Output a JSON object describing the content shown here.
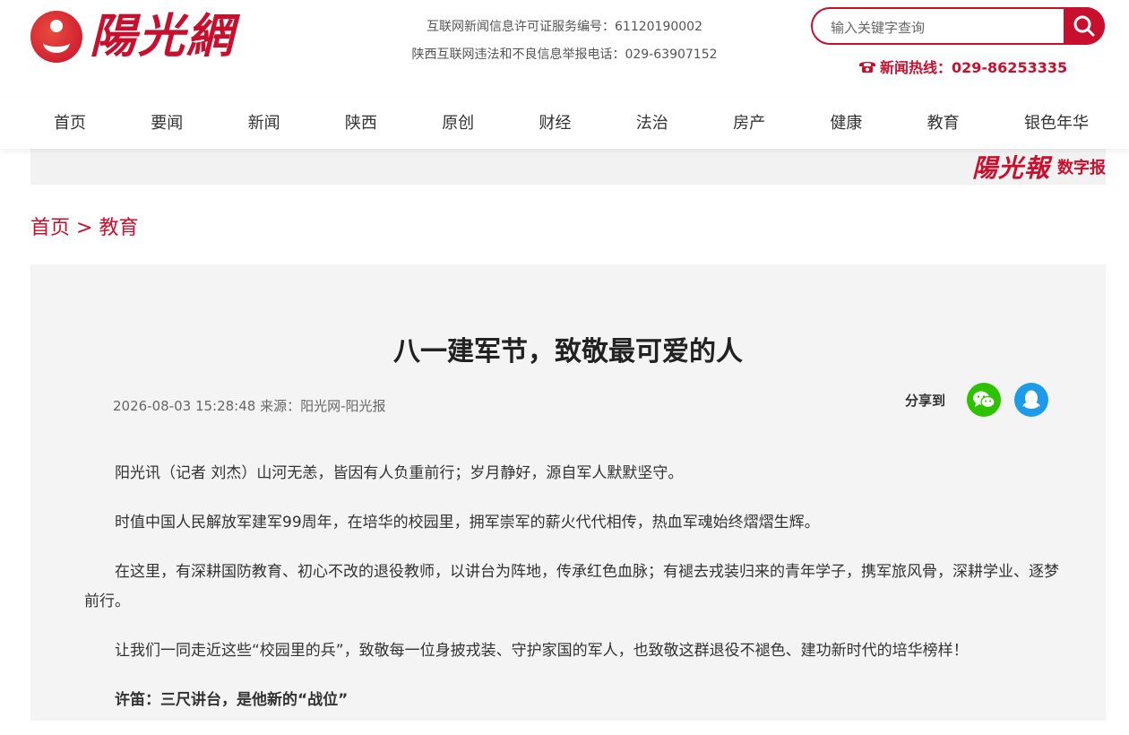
{
  "site": {
    "logo_text": "陽光網",
    "license_line1": "互联网新闻信息许可证服务编号：61120190002",
    "license_line2": "陕西互联网违法和不良信息举报电话：029-63907152",
    "search_placeholder": "输入关键字查询",
    "hotline": "新闻热线：029-86253335"
  },
  "nav": [
    "首页",
    "要闻",
    "新闻",
    "陕西",
    "原创",
    "财经",
    "法治",
    "房产",
    "健康",
    "教育",
    "银色年华"
  ],
  "epaper": {
    "logo_text": "陽光報",
    "label": "数字报"
  },
  "breadcrumb": {
    "home": "首页",
    "separator": ">",
    "current": "教育"
  },
  "article": {
    "title": "八一建军节，致敬最可爱的人",
    "meta": "2026-08-03 15:28:48 来源：阳光网-阳光报",
    "share_label": "分享到",
    "paragraphs": [
      "阳光讯（记者 刘杰）山河无恙，皆因有人负重前行；岁月静好，源自军人默默坚守。",
      "时值中国人民解放军建军99周年，在培华的校园里，拥军崇军的薪火代代相传，热血军魂始终熠熠生辉。",
      "在这里，有深耕国防教育、初心不改的退役教师，以讲台为阵地，传承红色血脉；有褪去戎装归来的青年学子，携军旅风骨，深耕学业、逐梦前行。",
      "让我们一同走近这些“校园里的兵”，致敬每一位身披戎装、守护家国的军人，也致敬这群退役不褪色、建功新时代的培华榜样！"
    ],
    "subheading": "许笛：三尺讲台，是他新的“战位”"
  },
  "colors": {
    "brand": "#c8102e",
    "wechat": "#2dc100",
    "qq": "#1e9be8"
  }
}
